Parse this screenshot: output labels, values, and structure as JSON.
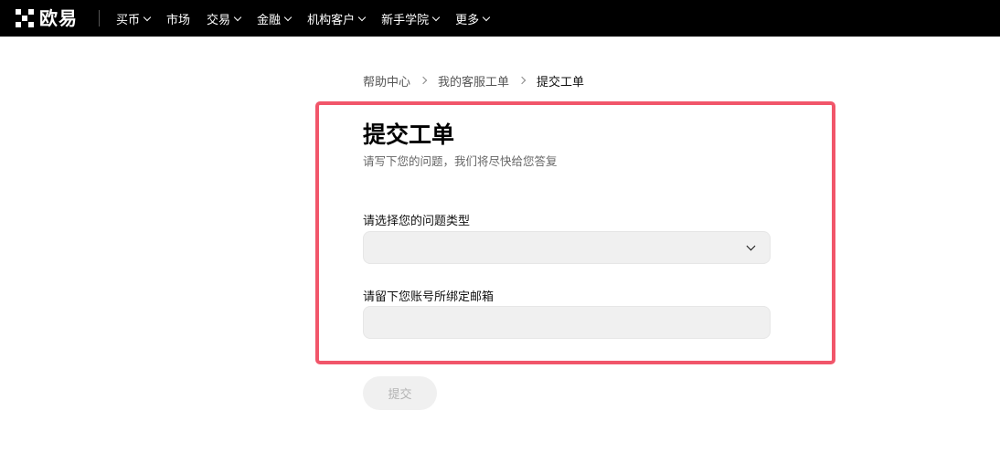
{
  "brand": {
    "name": "欧易",
    "logo_icon": "okx-logo-icon"
  },
  "nav": {
    "items": [
      {
        "label": "买币",
        "dropdown": true
      },
      {
        "label": "市场",
        "dropdown": false
      },
      {
        "label": "交易",
        "dropdown": true
      },
      {
        "label": "金融",
        "dropdown": true
      },
      {
        "label": "机构客户",
        "dropdown": true
      },
      {
        "label": "新手学院",
        "dropdown": true
      },
      {
        "label": "更多",
        "dropdown": true
      }
    ]
  },
  "breadcrumb": {
    "items": [
      "帮助中心",
      "我的客服工单",
      "提交工单"
    ]
  },
  "form": {
    "title": "提交工单",
    "subtitle": "请写下您的问题，我们将尽快给您答复",
    "issue_type_label": "请选择您的问题类型",
    "issue_type_value": "",
    "email_label": "请留下您账号所绑定邮箱",
    "email_value": "",
    "submit_label": "提交"
  },
  "colors": {
    "topbar": "#000000",
    "highlight_border": "#f1566a",
    "field_bg": "#f0f0f0",
    "submit_disabled_text": "#b3b3b3"
  }
}
